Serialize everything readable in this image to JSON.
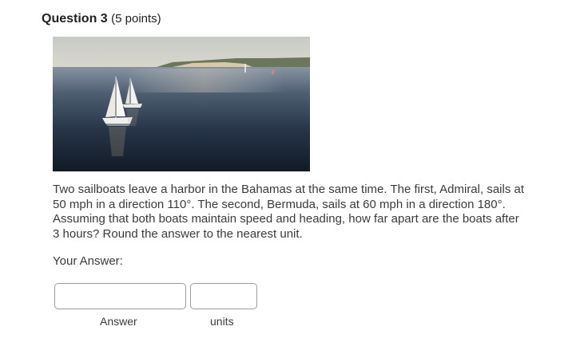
{
  "question": {
    "title": "Question 3",
    "points": "(5 points)",
    "image_alt": "two-sailboats-photo",
    "text": "Two sailboats leave a harbor in the Bahamas at the same time. The first, Admiral, sails at 50 mph in a direction 110°. The second, Bermuda, sails at 60 mph in a direction 180°.  Assuming that both boats maintain speed and heading, how far apart are the boats after 3 hours?  Round the answer to the nearest unit."
  },
  "answer": {
    "prompt": "Your Answer:",
    "answer_label": "Answer",
    "units_label": "units",
    "answer_value": "",
    "units_value": ""
  }
}
